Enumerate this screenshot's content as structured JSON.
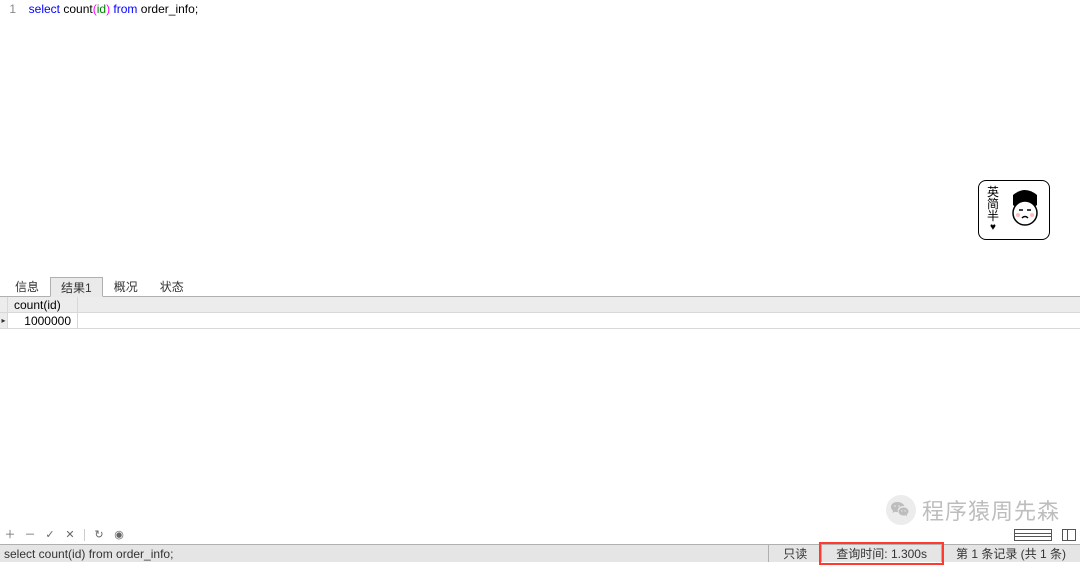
{
  "editor": {
    "line_no": "1",
    "tokens": {
      "select": "select",
      "count": "count",
      "lp": "(",
      "id": "id",
      "rp": ")",
      "from": "from",
      "table": "order_info",
      "semi": ";"
    }
  },
  "sticker": {
    "line1": "英",
    "line2": "简",
    "line3": "半",
    "heart": "♥"
  },
  "tabs": {
    "t1": "信息",
    "t2": "结果1",
    "t3": "概况",
    "t4": "状态"
  },
  "result": {
    "col": "count(id)",
    "val": "1000000"
  },
  "toolbar": {
    "plus": "＋",
    "minus": "－",
    "check": "✓",
    "x": "✕",
    "refresh": "↻",
    "stop": "◉"
  },
  "status": {
    "sql": "select count(id) from order_info;",
    "readonly": "只读",
    "time": "查询时间: 1.300s",
    "records": "第 1 条记录 (共 1 条)"
  },
  "watermark": {
    "text": "程序猿周先森"
  }
}
